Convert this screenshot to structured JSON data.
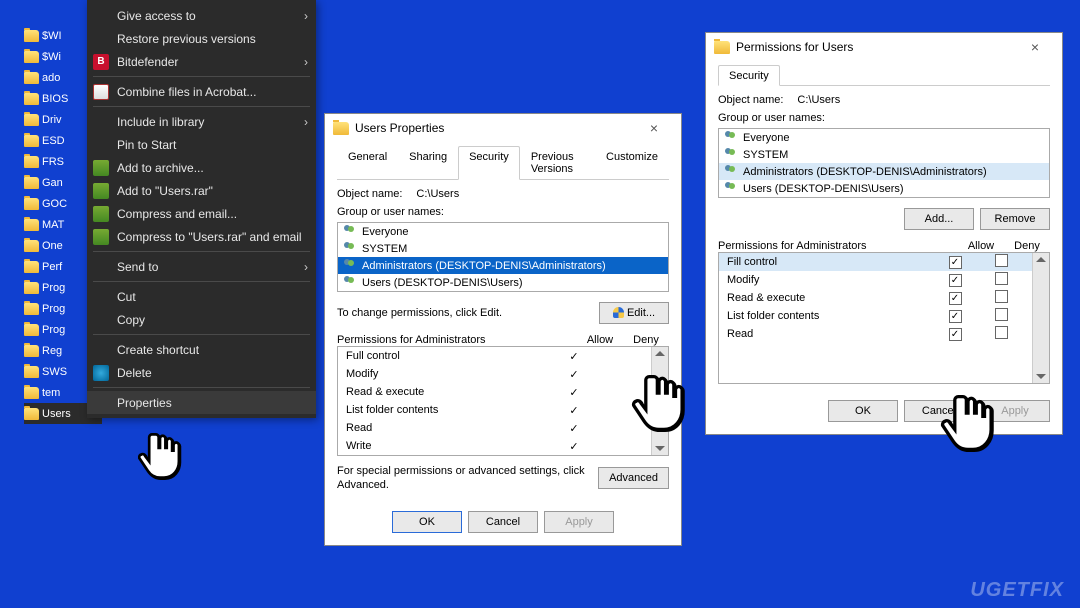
{
  "folders": [
    "$WI",
    "$Wi",
    "ado",
    "BIOS",
    "Driv",
    "ESD",
    "FRS",
    "Gan",
    "GOC",
    "MAT",
    "One",
    "Perf",
    "Prog",
    "Prog",
    "Prog",
    "Reg",
    "SWS",
    "tem",
    "Users"
  ],
  "ctx": {
    "give_access": "Give access to",
    "restore": "Restore previous versions",
    "bitdefender": "Bitdefender",
    "combine": "Combine files in Acrobat...",
    "include": "Include in library",
    "pin": "Pin to Start",
    "add_archive": "Add to archive...",
    "add_users": "Add to \"Users.rar\"",
    "compress_email": "Compress and email...",
    "compress_users_email": "Compress to \"Users.rar\" and email",
    "send_to": "Send to",
    "cut": "Cut",
    "copy": "Copy",
    "create_shortcut": "Create shortcut",
    "delete": "Delete",
    "properties": "Properties"
  },
  "props": {
    "title": "Users Properties",
    "tabs": [
      "General",
      "Sharing",
      "Security",
      "Previous Versions",
      "Customize"
    ],
    "object_label": "Object name:",
    "object_value": "C:\\Users",
    "group_label": "Group or user names:",
    "groups": [
      "Everyone",
      "SYSTEM",
      "Administrators (DESKTOP-DENIS\\Administrators)",
      "Users (DESKTOP-DENIS\\Users)"
    ],
    "change_hint": "To change permissions, click Edit.",
    "edit_btn": "Edit...",
    "perm_label": "Permissions for Administrators",
    "allow": "Allow",
    "deny": "Deny",
    "perms": [
      "Full control",
      "Modify",
      "Read & execute",
      "List folder contents",
      "Read",
      "Write"
    ],
    "special_hint": "For special permissions or advanced settings, click Advanced.",
    "advanced": "Advanced",
    "ok": "OK",
    "cancel": "Cancel",
    "apply": "Apply"
  },
  "perm2": {
    "title": "Permissions for Users",
    "tab": "Security",
    "object_label": "Object name:",
    "object_value": "C:\\Users",
    "group_label": "Group or user names:",
    "groups": [
      "Everyone",
      "SYSTEM",
      "Administrators (DESKTOP-DENIS\\Administrators)",
      "Users (DESKTOP-DENIS\\Users)"
    ],
    "add": "Add...",
    "remove": "Remove",
    "perm_label": "Permissions for Administrators",
    "allow": "Allow",
    "deny": "Deny",
    "perms": [
      "Fill control",
      "Modify",
      "Read & execute",
      "List folder contents",
      "Read"
    ],
    "ok": "OK",
    "cancel": "Cancel",
    "apply": "Apply"
  },
  "watermark": "UGETFIX"
}
